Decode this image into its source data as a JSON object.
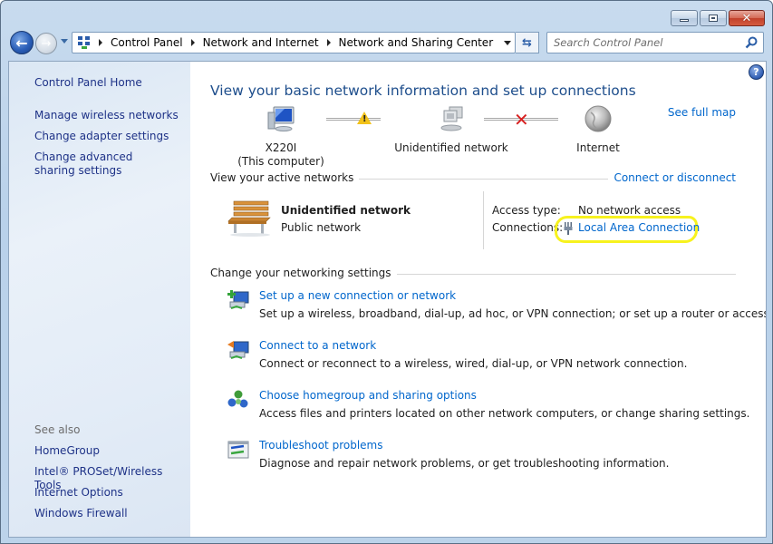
{
  "window": {
    "controls": {
      "minimize": "minimize",
      "maximize": "maximize",
      "close": "close"
    }
  },
  "navigation": {
    "back_icon": "back-arrow",
    "forward_icon": "forward-arrow",
    "breadcrumb": [
      "Control Panel",
      "Network and Internet",
      "Network and Sharing Center"
    ],
    "search_placeholder": "Search Control Panel"
  },
  "sidebar": {
    "home": "Control Panel Home",
    "links": [
      "Manage wireless networks",
      "Change adapter settings",
      "Change advanced sharing settings"
    ],
    "see_also_label": "See also",
    "see_also": [
      "HomeGroup",
      "Intel® PROSet/Wireless Tools",
      "Internet Options",
      "Windows Firewall"
    ]
  },
  "main": {
    "title": "View your basic network information and set up connections",
    "see_full_map": "See full map",
    "map": {
      "computer_name": "X220I",
      "computer_sub": "(This computer)",
      "network": "Unidentified network",
      "internet": "Internet",
      "link1_status": "warning",
      "link2_status": "disconnected"
    },
    "active_networks_label": "View your active networks",
    "connect_or_disconnect": "Connect or disconnect",
    "active_network": {
      "name": "Unidentified network",
      "type": "Public network",
      "access_type_label": "Access type:",
      "access_type_value": "No network access",
      "connections_label": "Connections:",
      "connection_value": "Local Area Connection"
    },
    "settings_label": "Change your networking settings",
    "tasks": [
      {
        "title": "Set up a new connection or network",
        "desc": "Set up a wireless, broadband, dial-up, ad hoc, or VPN connection; or set up a router or access point."
      },
      {
        "title": "Connect to a network",
        "desc": "Connect or reconnect to a wireless, wired, dial-up, or VPN network connection."
      },
      {
        "title": "Choose homegroup and sharing options",
        "desc": "Access files and printers located on other network computers, or change sharing settings."
      },
      {
        "title": "Troubleshoot problems",
        "desc": "Diagnose and repair network problems, or get troubleshooting information."
      }
    ]
  },
  "colors": {
    "link": "#0066cc",
    "title": "#1e4e8c",
    "sidebar_link": "#1e3287",
    "highlight": "#f7f21e"
  }
}
